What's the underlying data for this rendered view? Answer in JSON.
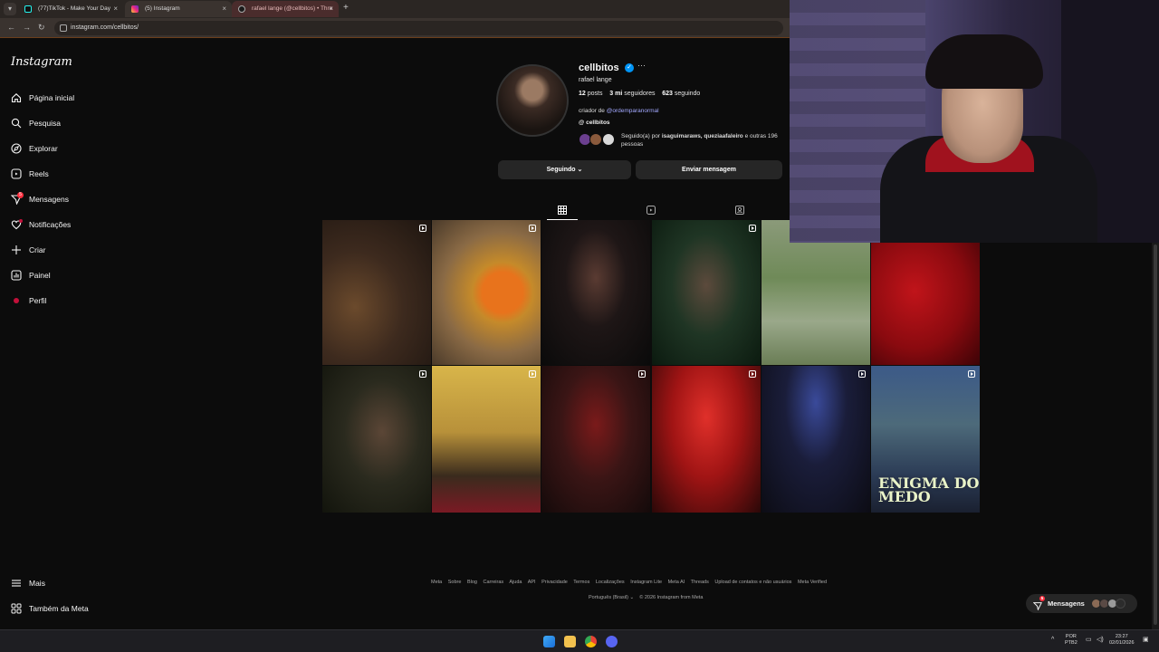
{
  "browser": {
    "tabs": [
      {
        "title": "(77)TikTok - Make Your Day"
      },
      {
        "title": "(5) Instagram"
      },
      {
        "title": "rafael lange (@cellbitos) • Thre"
      }
    ],
    "new_tab_label": "+",
    "url": "instagram.com/cellbitos/"
  },
  "sidebar": {
    "logo": "Instagram",
    "items": [
      {
        "label": "Página inicial",
        "icon": "home-icon"
      },
      {
        "label": "Pesquisa",
        "icon": "search-icon"
      },
      {
        "label": "Explorar",
        "icon": "compass-icon"
      },
      {
        "label": "Reels",
        "icon": "reels-icon"
      },
      {
        "label": "Mensagens",
        "icon": "messenger-icon",
        "badge": "5"
      },
      {
        "label": "Notificações",
        "icon": "heart-icon"
      },
      {
        "label": "Criar",
        "icon": "plus-icon"
      },
      {
        "label": "Painel",
        "icon": "dashboard-icon"
      },
      {
        "label": "Perfil",
        "icon": "profile-avatar-icon"
      }
    ],
    "more_label": "Mais",
    "meta_label": "Também da Meta"
  },
  "profile": {
    "username": "cellbitos",
    "full_name": "rafael lange",
    "posts_count": "12",
    "posts_label": "posts",
    "followers_count": "3 mi",
    "followers_label": "seguidores",
    "following_count": "623",
    "following_label": "seguindo",
    "bio_prefix": "criador de",
    "bio_link": "@ordemparanormal",
    "threads_handle": "cellbitos",
    "followed_by_prefix": "Seguido(a) por",
    "followed_by_names": "isaguimaraws, queziaafaleiro",
    "followed_by_suffix": "e outras 196 pessoas",
    "following_button": "Seguindo",
    "message_button": "Enviar mensagem"
  },
  "post_tabs": [
    {
      "icon": "grid-icon",
      "active": true
    },
    {
      "icon": "reels-tab-icon",
      "active": false
    },
    {
      "icon": "tagged-icon",
      "active": false
    }
  ],
  "posts": [
    {
      "description": "two-people-warm-room",
      "reel": true
    },
    {
      "description": "fanta-can-orange-hoodie",
      "reel": true
    },
    {
      "description": "man-dark-background",
      "reel": false
    },
    {
      "description": "man-green-lighting",
      "reel": true
    },
    {
      "description": "man-in-flower-field",
      "reel": false
    },
    {
      "description": "red-silhouette",
      "reel": false
    },
    {
      "description": "man-closeup-dark-green",
      "reel": true
    },
    {
      "description": "man-with-cake",
      "reel": true
    },
    {
      "description": "man-with-knife-red-mask",
      "reel": true
    },
    {
      "description": "man-red-studio",
      "reel": true
    },
    {
      "description": "man-at-desk-blue-light",
      "reel": true
    },
    {
      "description": "enigma-do-medo-art",
      "reel": true,
      "caption": "ENIGMA DO MEDO"
    }
  ],
  "footer": {
    "links": [
      "Meta",
      "Sobre",
      "Blog",
      "Carreiras",
      "Ajuda",
      "API",
      "Privacidade",
      "Termos",
      "Localizações",
      "Instagram Lite",
      "Meta AI",
      "Threads",
      "Upload de contatos e não usuários",
      "Meta Verified"
    ],
    "language": "Português (Brasil)",
    "copyright": "© 2026 Instagram from Meta"
  },
  "messages_pill": {
    "label": "Mensagens",
    "badge": "5"
  },
  "taskbar": {
    "lang_top": "POR",
    "lang_bottom": "PTB2",
    "time": "23:27",
    "date": "02/01/2026"
  }
}
